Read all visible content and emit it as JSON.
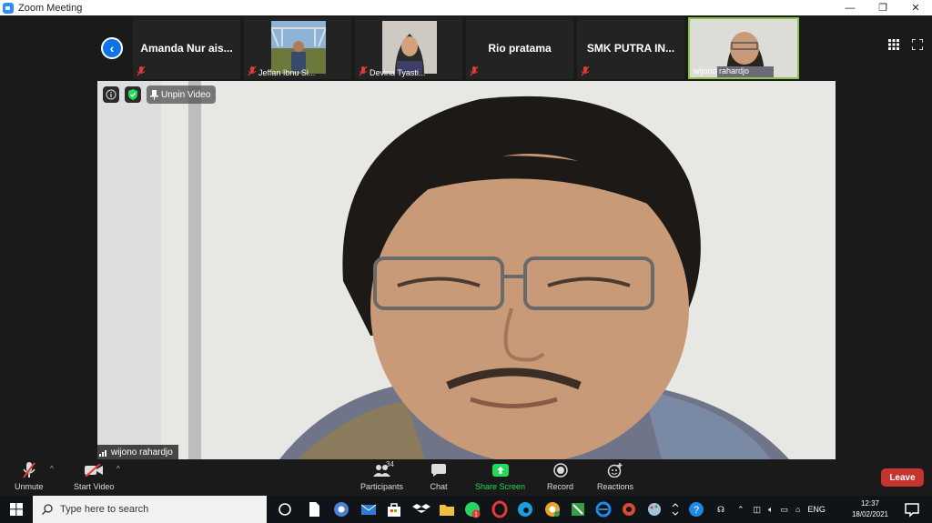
{
  "window": {
    "title": "Zoom Meeting",
    "minimize": "—",
    "restore": "❐",
    "close": "✕"
  },
  "participants_strip": [
    {
      "name": "Amanda Nur ais...",
      "muted": true,
      "video": false
    },
    {
      "name": "Jeffan Ibnu Si...",
      "muted": true,
      "video": true
    },
    {
      "name": "Devina Tyasti...",
      "muted": true,
      "video": true
    },
    {
      "name": "Rio pratama",
      "muted": true,
      "video": false
    },
    {
      "name": "SMK PUTRA IN...",
      "muted": true,
      "video": false
    },
    {
      "name": "wijono rahardjo",
      "muted": false,
      "video": true,
      "active": true
    }
  ],
  "main_video": {
    "unpin_label": "Unpin Video",
    "speaker_name": "wijono rahardjo"
  },
  "toolbar": {
    "unmute": "Unmute",
    "start_video": "Start Video",
    "participants": "Participants",
    "participants_count": "34",
    "chat": "Chat",
    "share_screen": "Share Screen",
    "record": "Record",
    "reactions": "Reactions",
    "leave": "Leave"
  },
  "taskbar": {
    "search_placeholder": "Type here to search",
    "language": "ENG",
    "time": "12:37",
    "date": "18/02/2021",
    "whatsapp_badge": "1"
  },
  "colors": {
    "zoom_blue": "#2D8CFF",
    "leave_red": "#c63430",
    "share_green": "#23d959",
    "active_border": "#8bc34a"
  }
}
